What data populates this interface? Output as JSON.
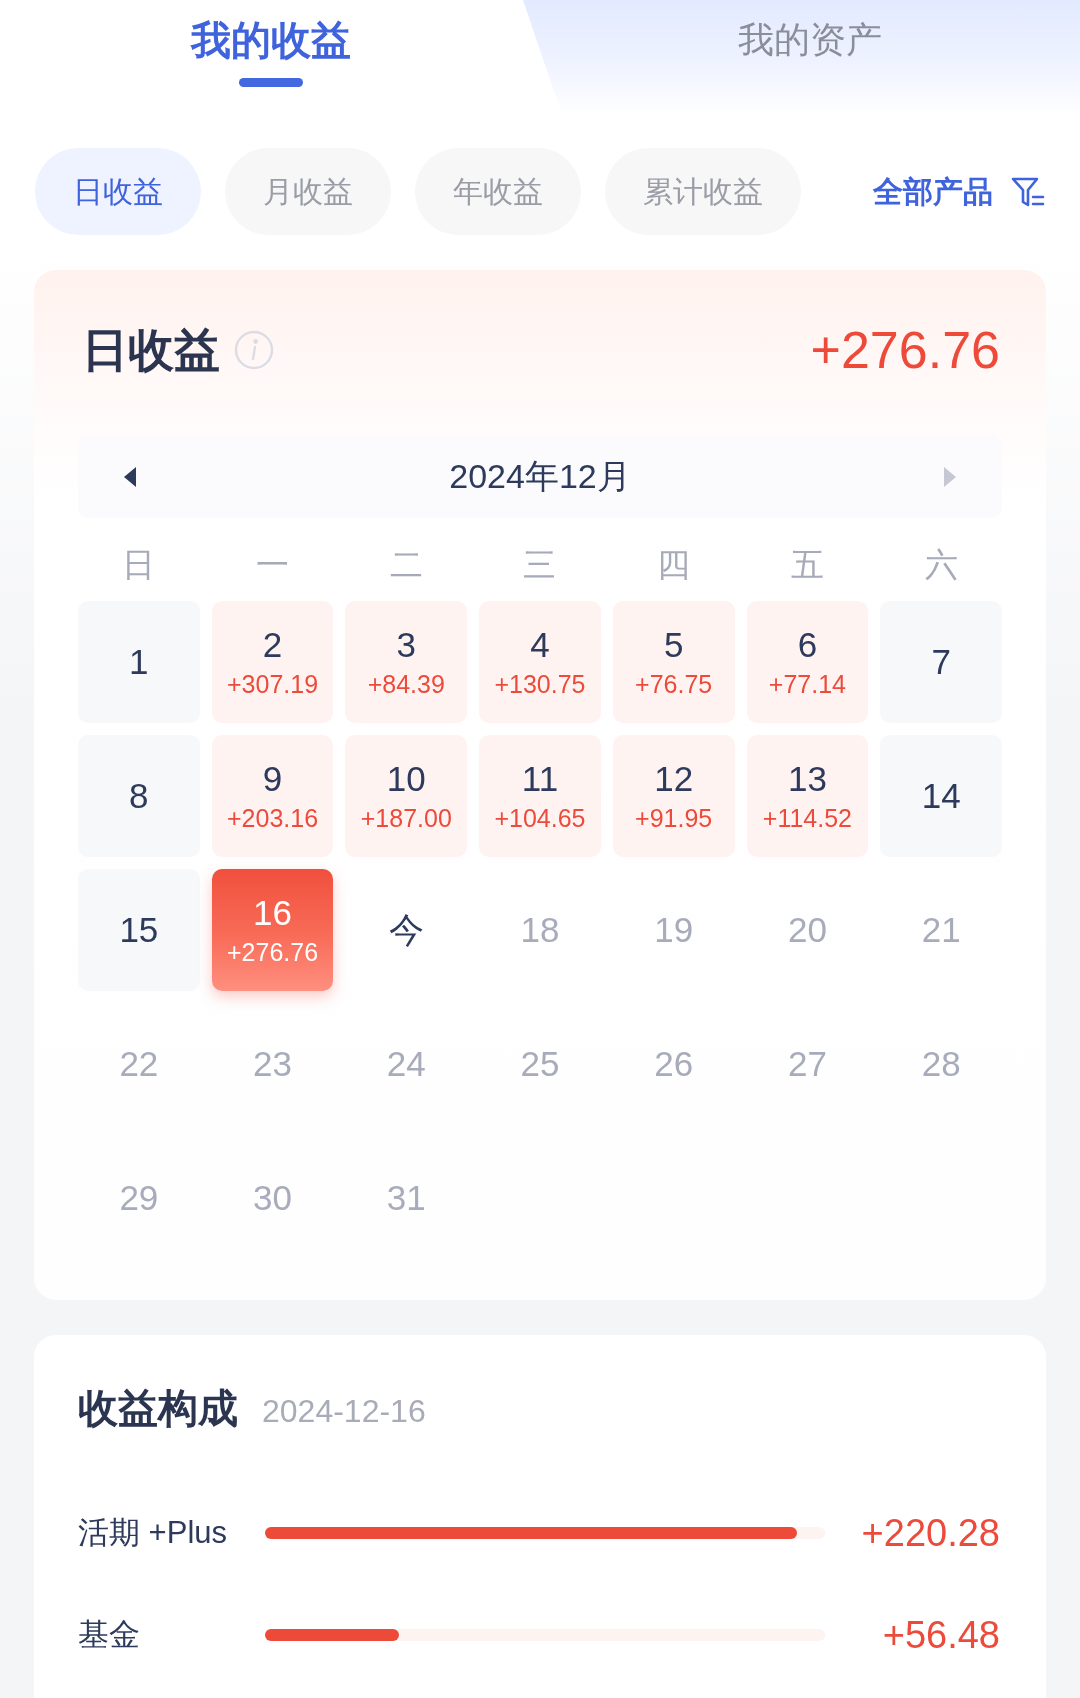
{
  "tabs": [
    {
      "label": "我的收益",
      "selected": true
    },
    {
      "label": "我的资产",
      "selected": false
    }
  ],
  "filters": [
    {
      "label": "日收益",
      "selected": true
    },
    {
      "label": "月收益",
      "selected": false
    },
    {
      "label": "年收益",
      "selected": false
    },
    {
      "label": "累计收益",
      "selected": false
    }
  ],
  "product_filter": {
    "label": "全部产品"
  },
  "summary": {
    "title": "日收益",
    "total": "+276.76"
  },
  "calendar": {
    "month": "2024年12月",
    "prev_button": {
      "disabled": false
    },
    "next_button": {
      "disabled": true
    },
    "weekdays": [
      "日",
      "一",
      "二",
      "三",
      "四",
      "五",
      "六"
    ],
    "days": [
      {
        "label": "1",
        "kind": "rest",
        "selected": false
      },
      {
        "label": "2",
        "amount": "+307.19",
        "kind": "income",
        "selected": false
      },
      {
        "label": "3",
        "amount": "+84.39",
        "kind": "income",
        "selected": false
      },
      {
        "label": "4",
        "amount": "+130.75",
        "kind": "income",
        "selected": false
      },
      {
        "label": "5",
        "amount": "+76.75",
        "kind": "income",
        "selected": false
      },
      {
        "label": "6",
        "amount": "+77.14",
        "kind": "income",
        "selected": false
      },
      {
        "label": "7",
        "kind": "rest",
        "selected": false
      },
      {
        "label": "8",
        "kind": "rest",
        "selected": false
      },
      {
        "label": "9",
        "amount": "+203.16",
        "kind": "income",
        "selected": false
      },
      {
        "label": "10",
        "amount": "+187.00",
        "kind": "income",
        "selected": false
      },
      {
        "label": "11",
        "amount": "+104.65",
        "kind": "income",
        "selected": false
      },
      {
        "label": "12",
        "amount": "+91.95",
        "kind": "income",
        "selected": false
      },
      {
        "label": "13",
        "amount": "+114.52",
        "kind": "income",
        "selected": false
      },
      {
        "label": "14",
        "kind": "rest",
        "selected": false
      },
      {
        "label": "15",
        "kind": "rest",
        "selected": false
      },
      {
        "label": "16",
        "amount": "+276.76",
        "kind": "income",
        "selected": true
      },
      {
        "label": "今",
        "kind": "today",
        "selected": false
      },
      {
        "label": "18",
        "kind": "future",
        "selected": false
      },
      {
        "label": "19",
        "kind": "future",
        "selected": false
      },
      {
        "label": "20",
        "kind": "future",
        "selected": false
      },
      {
        "label": "21",
        "kind": "future",
        "selected": false
      },
      {
        "label": "22",
        "kind": "future",
        "selected": false
      },
      {
        "label": "23",
        "kind": "future",
        "selected": false
      },
      {
        "label": "24",
        "kind": "future",
        "selected": false
      },
      {
        "label": "25",
        "kind": "future",
        "selected": false
      },
      {
        "label": "26",
        "kind": "future",
        "selected": false
      },
      {
        "label": "27",
        "kind": "future",
        "selected": false
      },
      {
        "label": "28",
        "kind": "future",
        "selected": false
      },
      {
        "label": "29",
        "kind": "future",
        "selected": false
      },
      {
        "label": "30",
        "kind": "future",
        "selected": false
      },
      {
        "label": "31",
        "kind": "future",
        "selected": false
      }
    ]
  },
  "composition": {
    "title": "收益构成",
    "date": "2024-12-16",
    "items": [
      {
        "name": "活期 +Plus",
        "level": 0.95,
        "amount": "+220.28"
      },
      {
        "name": "基金",
        "level": 0.24,
        "amount": "+56.48"
      }
    ]
  }
}
